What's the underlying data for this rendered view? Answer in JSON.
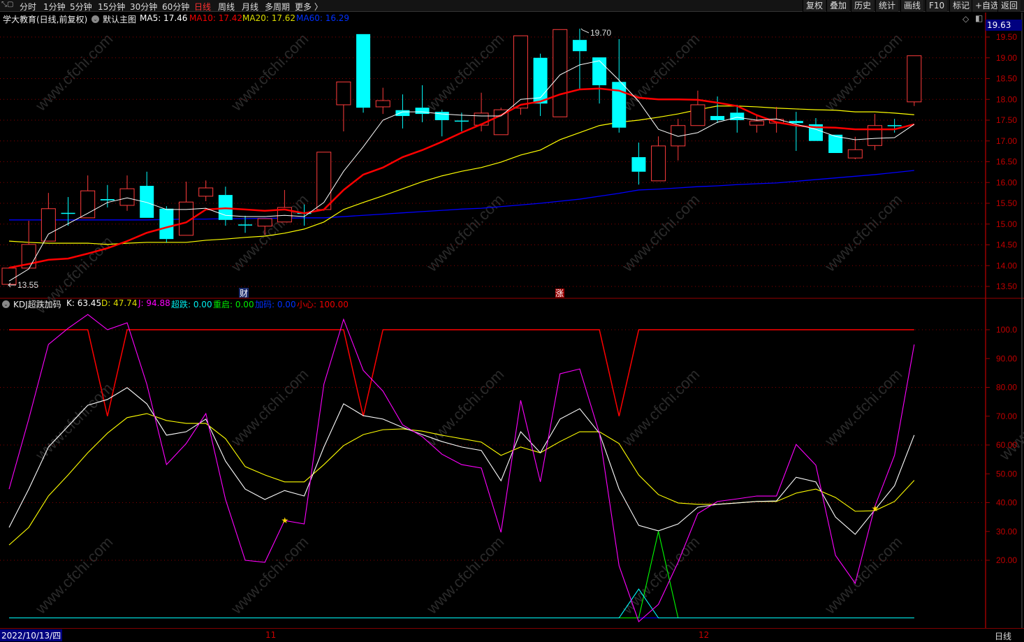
{
  "toolbar": {
    "left": [
      "分时",
      "1分钟",
      "5分钟",
      "15分钟",
      "30分钟",
      "60分钟",
      "日线",
      "周线",
      "月线",
      "多周期",
      "更多 〉"
    ],
    "active": "日线",
    "right": [
      "复权",
      "叠加",
      "历史",
      "统计",
      "画线",
      "F10",
      "标记",
      "+自选",
      "返回"
    ]
  },
  "info": {
    "title": "学大教育(日线,前复权)",
    "main_chart": "默认主图",
    "ma5": "MA5: 17.46",
    "ma10": "MA10: 17.42",
    "ma20": "MA20: 17.62",
    "ma60": "MA60: 16.29"
  },
  "kdj_info": {
    "name": "KDJ超跌加码",
    "k": "K: 63.45",
    "d": "D: 47.74",
    "j": "J: 94.88",
    "chaodie": "超跌: 0.00",
    "chongqi": "重启: 0.00",
    "jiama": "加码: 0.00",
    "xiaoxin": "小心: 100.00"
  },
  "current_price": "19.63",
  "markers": {
    "high": "19.70",
    "low": "13.55",
    "cai": "财",
    "zhang": "涨"
  },
  "footer": {
    "date": "2022/10/13/四",
    "month1": "11",
    "month2": "12",
    "period": "日线"
  },
  "watermark": "www.cfchi.com",
  "colors": {
    "up": "#ff3c3c",
    "down": "#00ffff",
    "ma5": "#ffffff",
    "ma10": "#ff0000",
    "ma20": "#ffff00",
    "ma60": "#0000ff",
    "k": "#ffffff",
    "d": "#ffff00",
    "j": "#ff00ff",
    "chaodie": "#00ffff",
    "chongqi": "#00ff00",
    "jiama": "#0000ff",
    "xiaoxin": "#ff0000",
    "axis": "#c00000"
  },
  "chart_data": [
    {
      "type": "candlestick",
      "title": "学大教育(日线,前复权)",
      "ylim": [
        13.4,
        19.7
      ],
      "y_ticks": [
        "19.50",
        "19.00",
        "18.50",
        "18.00",
        "17.50",
        "17.00",
        "16.50",
        "16.00",
        "15.50",
        "15.00",
        "14.50",
        "14.00",
        "13.50"
      ],
      "ohlc": [
        [
          13.55,
          13.96,
          13.55,
          13.94
        ],
        [
          13.94,
          15.08,
          13.94,
          14.51
        ],
        [
          14.59,
          15.75,
          14.59,
          15.37
        ],
        [
          15.27,
          15.65,
          14.96,
          15.26
        ],
        [
          15.15,
          16.17,
          15.15,
          15.8
        ],
        [
          15.6,
          15.94,
          15.4,
          15.57
        ],
        [
          15.45,
          16.17,
          15.32,
          15.85
        ],
        [
          15.92,
          16.26,
          15.15,
          15.15
        ],
        [
          15.37,
          15.43,
          14.56,
          14.64
        ],
        [
          14.73,
          16.02,
          14.73,
          15.53
        ],
        [
          15.67,
          16.05,
          15.55,
          15.87
        ],
        [
          15.7,
          15.9,
          14.96,
          15.1
        ],
        [
          14.99,
          15.2,
          14.79,
          14.98
        ],
        [
          14.95,
          15.13,
          14.74,
          15.13
        ],
        [
          15.05,
          15.82,
          15.05,
          15.4
        ],
        [
          15.27,
          15.47,
          14.96,
          15.26
        ],
        [
          15.35,
          16.73,
          15.32,
          16.73
        ],
        [
          17.87,
          18.42,
          17.23,
          18.42
        ],
        [
          19.57,
          19.57,
          17.68,
          17.8
        ],
        [
          17.82,
          18.28,
          17.65,
          17.97
        ],
        [
          17.74,
          18.12,
          17.3,
          17.6
        ],
        [
          17.8,
          18.34,
          17.45,
          17.65
        ],
        [
          17.7,
          17.75,
          17.11,
          17.5
        ],
        [
          17.49,
          17.68,
          17.23,
          17.48
        ],
        [
          17.38,
          18.16,
          17.23,
          17.67
        ],
        [
          17.15,
          17.8,
          17.15,
          17.75
        ],
        [
          17.79,
          19.53,
          17.63,
          19.53
        ],
        [
          19.0,
          19.1,
          17.6,
          17.9
        ],
        [
          17.58,
          19.68,
          17.58,
          19.68
        ],
        [
          19.43,
          19.7,
          18.24,
          19.16
        ],
        [
          19.01,
          19.01,
          17.9,
          18.34
        ],
        [
          18.42,
          19.45,
          17.2,
          17.32
        ],
        [
          16.61,
          16.96,
          15.95,
          16.26
        ],
        [
          16.04,
          17.11,
          16.04,
          16.88
        ],
        [
          16.88,
          17.53,
          16.53,
          17.37
        ],
        [
          17.37,
          18.21,
          17.37,
          17.87
        ],
        [
          17.6,
          18.07,
          17.43,
          17.5
        ],
        [
          17.68,
          17.87,
          17.2,
          17.5
        ],
        [
          17.38,
          17.63,
          17.2,
          17.48
        ],
        [
          17.43,
          17.82,
          17.2,
          17.52
        ],
        [
          17.48,
          17.7,
          16.76,
          17.43
        ],
        [
          17.4,
          17.55,
          17.0,
          17.0
        ],
        [
          17.15,
          17.15,
          16.71,
          16.71
        ],
        [
          16.59,
          17.1,
          16.56,
          16.79
        ],
        [
          16.89,
          17.65,
          16.78,
          17.37
        ],
        [
          17.38,
          17.53,
          17.2,
          17.37
        ],
        [
          17.94,
          19.05,
          17.84,
          19.05
        ]
      ],
      "series": [
        {
          "name": "MA5",
          "values": [
            13.63,
            13.92,
            14.76,
            15.01,
            15.26,
            15.52,
            15.63,
            15.52,
            15.35,
            15.35,
            15.38,
            15.21,
            15.18,
            15.18,
            15.21,
            15.18,
            15.52,
            16.27,
            16.86,
            17.5,
            17.7,
            17.7,
            17.65,
            17.62,
            17.6,
            17.6,
            18.0,
            18.04,
            18.59,
            18.83,
            18.93,
            18.46,
            17.95,
            17.28,
            17.11,
            17.2,
            17.45,
            17.57,
            17.5,
            17.53,
            17.4,
            17.28,
            17.11,
            17.03,
            17.06,
            17.08,
            17.4
          ]
        },
        {
          "name": "MA10",
          "values": [
            13.95,
            14.04,
            14.14,
            14.17,
            14.29,
            14.42,
            14.59,
            14.79,
            14.92,
            15.04,
            15.35,
            15.38,
            15.35,
            15.32,
            15.35,
            15.26,
            15.35,
            15.82,
            16.19,
            16.36,
            16.61,
            16.78,
            16.98,
            17.2,
            17.4,
            17.62,
            17.87,
            17.95,
            18.12,
            18.24,
            18.26,
            18.21,
            18.04,
            18.0,
            18.0,
            17.99,
            17.92,
            17.84,
            17.62,
            17.45,
            17.37,
            17.33,
            17.32,
            17.28,
            17.28,
            17.28,
            17.4
          ]
        },
        {
          "name": "MA20",
          "values": [
            14.59,
            14.56,
            14.54,
            14.54,
            14.54,
            14.51,
            14.54,
            14.56,
            14.56,
            14.56,
            14.61,
            14.64,
            14.68,
            14.71,
            14.78,
            14.88,
            15.05,
            15.35,
            15.52,
            15.68,
            15.85,
            16.02,
            16.16,
            16.27,
            16.36,
            16.49,
            16.66,
            16.78,
            17.03,
            17.2,
            17.37,
            17.45,
            17.5,
            17.57,
            17.65,
            17.75,
            17.84,
            17.84,
            17.82,
            17.79,
            17.77,
            17.75,
            17.74,
            17.7,
            17.7,
            17.67,
            17.63
          ]
        },
        {
          "name": "MA60",
          "values": [
            15.1,
            15.1,
            15.1,
            15.1,
            15.1,
            15.1,
            15.1,
            15.1,
            15.11,
            15.12,
            15.12,
            15.13,
            15.13,
            15.14,
            15.14,
            15.15,
            15.15,
            15.18,
            15.21,
            15.24,
            15.27,
            15.3,
            15.33,
            15.36,
            15.38,
            15.42,
            15.46,
            15.5,
            15.55,
            15.6,
            15.67,
            15.74,
            15.82,
            15.84,
            15.87,
            15.9,
            15.92,
            15.95,
            15.97,
            15.99,
            16.03,
            16.07,
            16.11,
            16.15,
            16.19,
            16.24,
            16.29
          ]
        }
      ]
    },
    {
      "type": "line",
      "title": "KDJ超跌加码",
      "ylim": [
        0,
        104
      ],
      "y_ticks": [
        "100.0",
        "90.00",
        "80.00",
        "70.00",
        "60.00",
        "50.00",
        "40.00",
        "30.00",
        "20.00"
      ],
      "series": [
        {
          "name": "K",
          "values": [
            31.4,
            44.7,
            59.3,
            66.5,
            73.8,
            75.8,
            79.9,
            74.3,
            63.4,
            64.6,
            69.0,
            54.4,
            44.7,
            41.1,
            44.2,
            42.3,
            59.3,
            74.3,
            70.2,
            69.0,
            66.1,
            63.6,
            61.2,
            59.3,
            58.1,
            47.6,
            64.6,
            57.3,
            69.0,
            72.6,
            64.1,
            44.7,
            32.1,
            30.2,
            32.6,
            38.4,
            39.4,
            39.9,
            40.4,
            40.6,
            48.8,
            47.2,
            35.0,
            29.0,
            37.5,
            45.9,
            63.45
          ]
        },
        {
          "name": "D",
          "values": [
            25.3,
            31.4,
            42.3,
            49.6,
            57.3,
            64.1,
            69.5,
            70.9,
            68.5,
            67.5,
            67.5,
            62.2,
            52.5,
            49.6,
            47.2,
            47.2,
            53.2,
            59.8,
            63.6,
            65.3,
            65.6,
            64.8,
            63.4,
            62.2,
            61.0,
            56.4,
            59.3,
            57.3,
            61.2,
            64.6,
            64.6,
            60.5,
            49.6,
            42.8,
            39.9,
            39.4,
            39.4,
            39.9,
            40.4,
            40.4,
            43.3,
            44.7,
            41.8,
            37.0,
            37.2,
            40.4,
            47.74
          ]
        },
        {
          "name": "J",
          "values": [
            44.7,
            69.0,
            94.9,
            100.5,
            105.3,
            100.0,
            102.4,
            81.1,
            53.2,
            60.5,
            70.9,
            41.1,
            20.0,
            19.3,
            33.8,
            32.6,
            81.1,
            103.6,
            85.9,
            78.7,
            67.0,
            62.9,
            56.8,
            53.2,
            52.0,
            29.7,
            75.5,
            47.2,
            84.7,
            86.4,
            64.1,
            18.1,
            -1.3,
            4.7,
            19.3,
            36.2,
            40.4,
            41.3,
            42.3,
            42.3,
            60.2,
            53.0,
            21.7,
            12.0,
            38.7,
            56.4,
            94.88
          ]
        },
        {
          "name": "超跌",
          "values": [
            0,
            0,
            0,
            0,
            0,
            0,
            0,
            0,
            0,
            0,
            0,
            0,
            0,
            0,
            0,
            0,
            0,
            0,
            0,
            0,
            0,
            0,
            0,
            0,
            0,
            0,
            0,
            0,
            0,
            0,
            0,
            0,
            10,
            0,
            0,
            0,
            0,
            0,
            0,
            0,
            0,
            0,
            0,
            0,
            0,
            0,
            0
          ]
        },
        {
          "name": "重启",
          "values": [
            0,
            0,
            0,
            0,
            0,
            0,
            0,
            0,
            0,
            0,
            0,
            0,
            0,
            0,
            0,
            0,
            0,
            0,
            0,
            0,
            0,
            0,
            0,
            0,
            0,
            0,
            0,
            0,
            0,
            0,
            0,
            0,
            0,
            30,
            0,
            0,
            0,
            0,
            0,
            0,
            0,
            0,
            0,
            0,
            0,
            0,
            0
          ]
        },
        {
          "name": "加码",
          "values": [
            0,
            0,
            0,
            0,
            0,
            0,
            0,
            0,
            0,
            0,
            0,
            0,
            0,
            0,
            0,
            0,
            0,
            0,
            0,
            0,
            0,
            0,
            0,
            0,
            0,
            0,
            0,
            0,
            0,
            0,
            0,
            0,
            0,
            0,
            0,
            0,
            0,
            0,
            0,
            0,
            0,
            0,
            0,
            0,
            0,
            0,
            0
          ]
        },
        {
          "name": "小心",
          "values": [
            100,
            100,
            100,
            100,
            100,
            70,
            100,
            100,
            100,
            100,
            100,
            100,
            100,
            100,
            100,
            100,
            100,
            100,
            70,
            100,
            100,
            100,
            100,
            100,
            100,
            100,
            100,
            100,
            100,
            100,
            100,
            70,
            100,
            100,
            100,
            100,
            100,
            100,
            100,
            100,
            100,
            100,
            100,
            100,
            100,
            100,
            100
          ]
        }
      ],
      "star_points": [
        {
          "index": 14,
          "value": 33.8
        },
        {
          "index": 44,
          "value": 38.0
        }
      ]
    }
  ]
}
